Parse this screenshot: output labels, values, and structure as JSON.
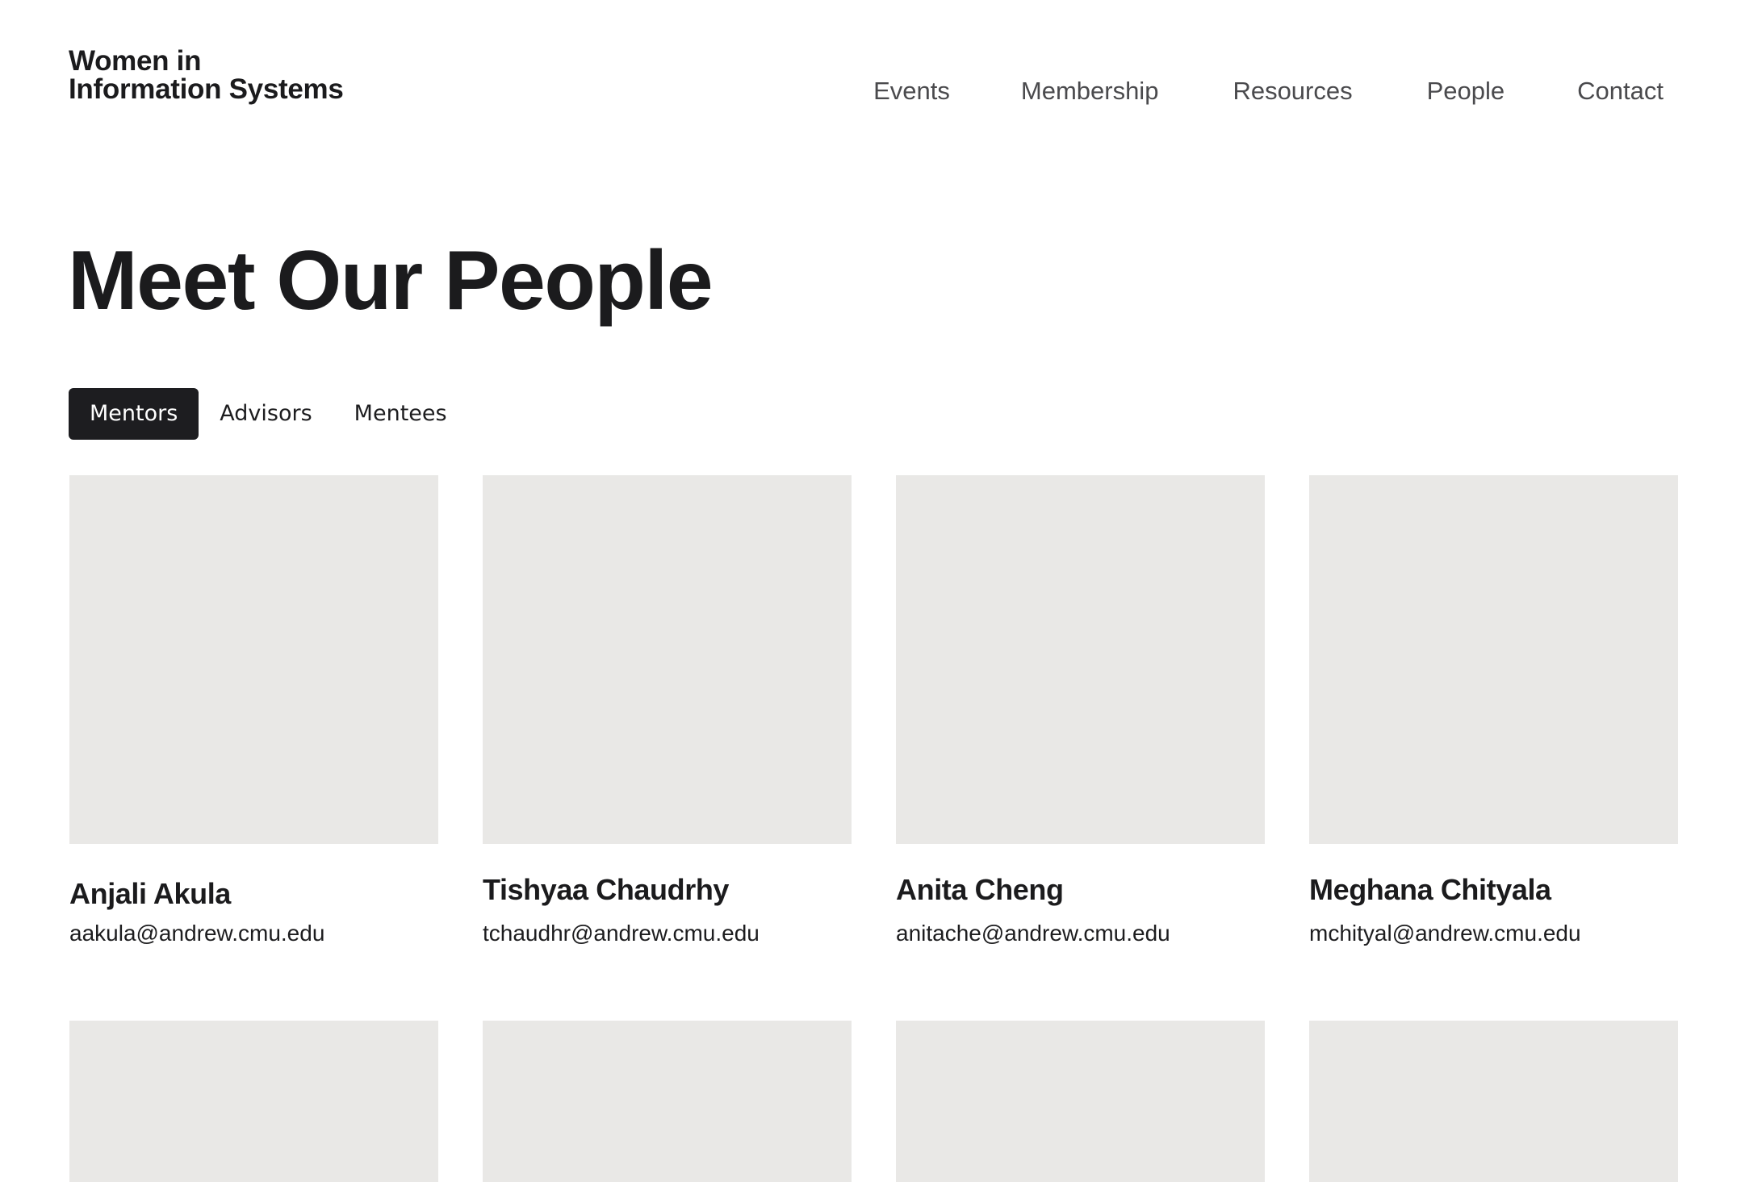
{
  "site": {
    "logo_line1": "Women in",
    "logo_line2": "Information Systems"
  },
  "nav": {
    "events": "Events",
    "membership": "Membership",
    "resources": "Resources",
    "people": "People",
    "contact": "Contact"
  },
  "page": {
    "title": "Meet Our People"
  },
  "tabs": {
    "mentors": "Mentors",
    "advisors": "Advisors",
    "mentees": "Mentees",
    "active": "Mentors"
  },
  "people": [
    {
      "name": "Anjali Akula",
      "email": "aakula@andrew.cmu.edu"
    },
    {
      "name": "Tishyaa Chaudrhy",
      "email": "tchaudhr@andrew.cmu.edu"
    },
    {
      "name": "Anita Cheng",
      "email": "anitache@andrew.cmu.edu"
    },
    {
      "name": "Meghana Chityala",
      "email": "mchityal@andrew.cmu.edu"
    }
  ],
  "colors": {
    "text": "#1b1b1d",
    "nav_text": "#4a4a4d",
    "active_tab_bg": "#1d1d20",
    "photo_placeholder": "#e9e8e6",
    "background": "#ffffff"
  }
}
